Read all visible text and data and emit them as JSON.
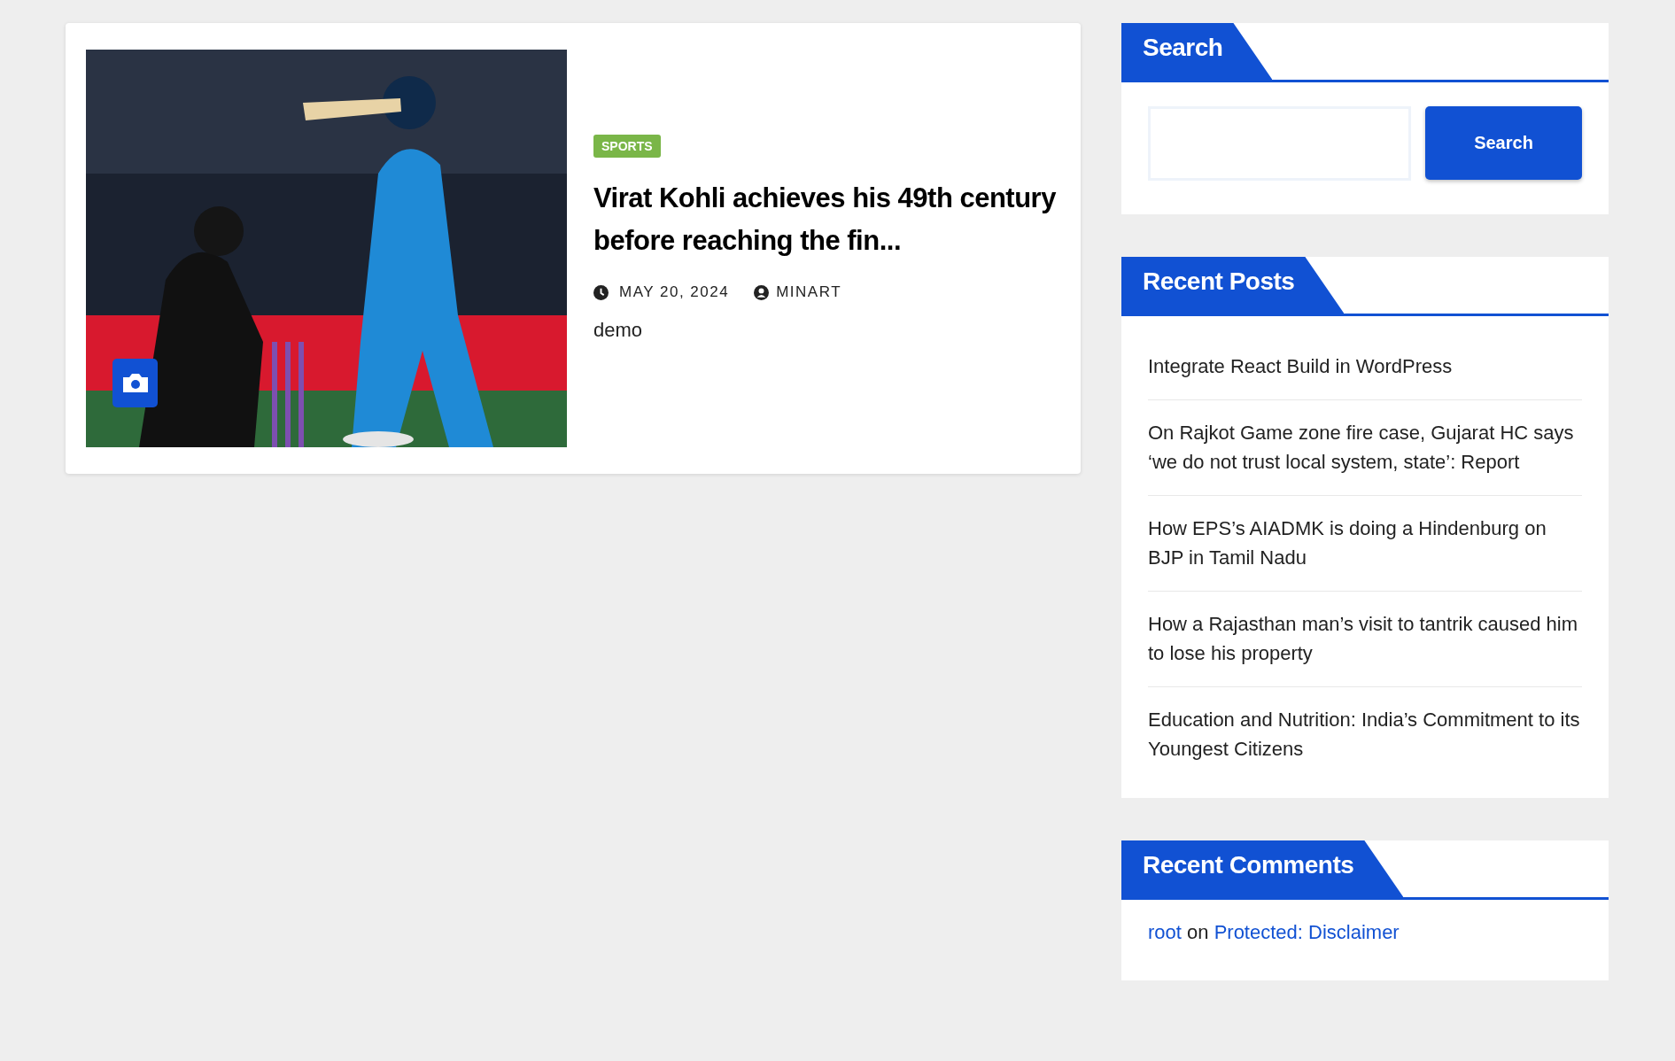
{
  "post": {
    "category": "SPORTS",
    "title": "Virat Kohli achieves his 49th century before reaching the fin...",
    "date": "MAY 20, 2024",
    "author": "MINART",
    "excerpt": "demo"
  },
  "search_widget": {
    "title": "Search",
    "button": "Search"
  },
  "recent_posts": {
    "title": "Recent Posts",
    "items": [
      {
        "title": "Integrate React Build in WordPress"
      },
      {
        "title": "On Rajkot Game zone fire case, Gujarat HC says ‘we do not trust local system, state’: Report"
      },
      {
        "title": "How EPS’s AIADMK is doing a Hindenburg on BJP in Tamil Nadu"
      },
      {
        "title": "How a Rajasthan man’s visit to tantrik caused him to lose his property"
      },
      {
        "title": "Education and Nutrition: India’s Commitment to its Youngest Citizens"
      }
    ]
  },
  "recent_comments": {
    "title": "Recent Comments",
    "items": [
      {
        "author": "root",
        "joiner": "on",
        "post": "Protected: Disclaimer"
      }
    ]
  }
}
